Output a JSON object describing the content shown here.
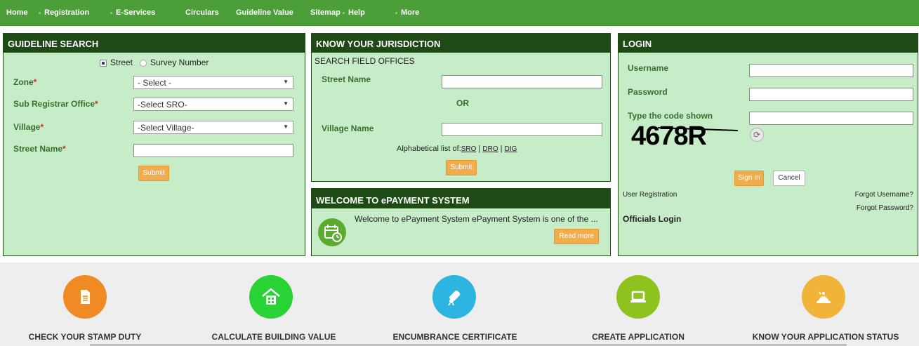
{
  "nav": {
    "items": [
      "Home",
      "Registration",
      "E-Services",
      "Circulars",
      "Guideline Value",
      "Sitemap",
      "Help",
      "More"
    ]
  },
  "guideline": {
    "title": "GUIDELINE SEARCH",
    "radio_street": "Street",
    "radio_survey": "Survey Number",
    "zone_label": "Zone",
    "zone_value": "- Select -",
    "sro_label": "Sub Registrar Office",
    "sro_value": "-Select SRO-",
    "village_label": "Village",
    "village_value": "-Select Village-",
    "street_label": "Street Name",
    "required_mark": "*",
    "submit": "Submit"
  },
  "jurisdiction": {
    "title": "KNOW YOUR JURISDICTION",
    "subtitle": "SEARCH FIELD OFFICES",
    "street_label": "Street Name",
    "or_text": "OR",
    "village_label": "Village Name",
    "alpha_text": "Alphabetical list of:",
    "sro_link": "SRO",
    "dro_link": "DRO",
    "dig_link": "DIG",
    "sep": "|",
    "submit": "Submit"
  },
  "epayment": {
    "title": "WELCOME TO ePAYMENT SYSTEM",
    "text": "Welcome to ePayment System ePayment System is one of the ...",
    "read_more": "Read more"
  },
  "login": {
    "title": "LOGIN",
    "username_label": "Username",
    "password_label": "Password",
    "code_label": "Type the code shown",
    "captcha": "4678R",
    "sign_in": "Sign In",
    "cancel": "Cancel",
    "user_registration": "User Registration",
    "forgot_username": "Forgot Username?",
    "forgot_password": "Forgot Password?",
    "officials_login": "Officials Login"
  },
  "services": [
    {
      "label": "CHECK YOUR STAMP DUTY",
      "color": "#f08a24",
      "icon": "document-icon"
    },
    {
      "label": "CALCULATE BUILDING VALUE",
      "color": "#29d235",
      "icon": "building-icon"
    },
    {
      "label": "ENCUMBRANCE CERTIFICATE",
      "color": "#2bb5e0",
      "icon": "certificate-icon"
    },
    {
      "label": "CREATE APPLICATION",
      "color": "#8ec21f",
      "icon": "laptop-icon"
    },
    {
      "label": "KNOW YOUR APPLICATION STATUS",
      "color": "#f0b43a",
      "icon": "status-icon"
    }
  ]
}
